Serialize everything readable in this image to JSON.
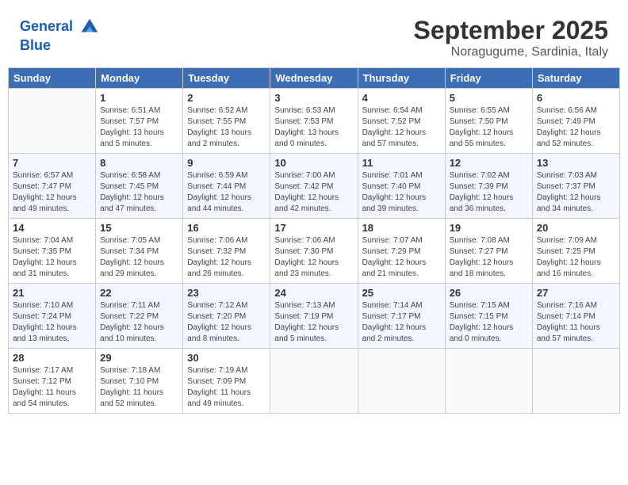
{
  "header": {
    "logo_line1": "General",
    "logo_line2": "Blue",
    "month": "September 2025",
    "location": "Noragugume, Sardinia, Italy"
  },
  "days_of_week": [
    "Sunday",
    "Monday",
    "Tuesday",
    "Wednesday",
    "Thursday",
    "Friday",
    "Saturday"
  ],
  "weeks": [
    [
      {
        "day": "",
        "info": ""
      },
      {
        "day": "1",
        "info": "Sunrise: 6:51 AM\nSunset: 7:57 PM\nDaylight: 13 hours\nand 5 minutes."
      },
      {
        "day": "2",
        "info": "Sunrise: 6:52 AM\nSunset: 7:55 PM\nDaylight: 13 hours\nand 2 minutes."
      },
      {
        "day": "3",
        "info": "Sunrise: 6:53 AM\nSunset: 7:53 PM\nDaylight: 13 hours\nand 0 minutes."
      },
      {
        "day": "4",
        "info": "Sunrise: 6:54 AM\nSunset: 7:52 PM\nDaylight: 12 hours\nand 57 minutes."
      },
      {
        "day": "5",
        "info": "Sunrise: 6:55 AM\nSunset: 7:50 PM\nDaylight: 12 hours\nand 55 minutes."
      },
      {
        "day": "6",
        "info": "Sunrise: 6:56 AM\nSunset: 7:49 PM\nDaylight: 12 hours\nand 52 minutes."
      }
    ],
    [
      {
        "day": "7",
        "info": "Sunrise: 6:57 AM\nSunset: 7:47 PM\nDaylight: 12 hours\nand 49 minutes."
      },
      {
        "day": "8",
        "info": "Sunrise: 6:58 AM\nSunset: 7:45 PM\nDaylight: 12 hours\nand 47 minutes."
      },
      {
        "day": "9",
        "info": "Sunrise: 6:59 AM\nSunset: 7:44 PM\nDaylight: 12 hours\nand 44 minutes."
      },
      {
        "day": "10",
        "info": "Sunrise: 7:00 AM\nSunset: 7:42 PM\nDaylight: 12 hours\nand 42 minutes."
      },
      {
        "day": "11",
        "info": "Sunrise: 7:01 AM\nSunset: 7:40 PM\nDaylight: 12 hours\nand 39 minutes."
      },
      {
        "day": "12",
        "info": "Sunrise: 7:02 AM\nSunset: 7:39 PM\nDaylight: 12 hours\nand 36 minutes."
      },
      {
        "day": "13",
        "info": "Sunrise: 7:03 AM\nSunset: 7:37 PM\nDaylight: 12 hours\nand 34 minutes."
      }
    ],
    [
      {
        "day": "14",
        "info": "Sunrise: 7:04 AM\nSunset: 7:35 PM\nDaylight: 12 hours\nand 31 minutes."
      },
      {
        "day": "15",
        "info": "Sunrise: 7:05 AM\nSunset: 7:34 PM\nDaylight: 12 hours\nand 29 minutes."
      },
      {
        "day": "16",
        "info": "Sunrise: 7:06 AM\nSunset: 7:32 PM\nDaylight: 12 hours\nand 26 minutes."
      },
      {
        "day": "17",
        "info": "Sunrise: 7:06 AM\nSunset: 7:30 PM\nDaylight: 12 hours\nand 23 minutes."
      },
      {
        "day": "18",
        "info": "Sunrise: 7:07 AM\nSunset: 7:29 PM\nDaylight: 12 hours\nand 21 minutes."
      },
      {
        "day": "19",
        "info": "Sunrise: 7:08 AM\nSunset: 7:27 PM\nDaylight: 12 hours\nand 18 minutes."
      },
      {
        "day": "20",
        "info": "Sunrise: 7:09 AM\nSunset: 7:25 PM\nDaylight: 12 hours\nand 16 minutes."
      }
    ],
    [
      {
        "day": "21",
        "info": "Sunrise: 7:10 AM\nSunset: 7:24 PM\nDaylight: 12 hours\nand 13 minutes."
      },
      {
        "day": "22",
        "info": "Sunrise: 7:11 AM\nSunset: 7:22 PM\nDaylight: 12 hours\nand 10 minutes."
      },
      {
        "day": "23",
        "info": "Sunrise: 7:12 AM\nSunset: 7:20 PM\nDaylight: 12 hours\nand 8 minutes."
      },
      {
        "day": "24",
        "info": "Sunrise: 7:13 AM\nSunset: 7:19 PM\nDaylight: 12 hours\nand 5 minutes."
      },
      {
        "day": "25",
        "info": "Sunrise: 7:14 AM\nSunset: 7:17 PM\nDaylight: 12 hours\nand 2 minutes."
      },
      {
        "day": "26",
        "info": "Sunrise: 7:15 AM\nSunset: 7:15 PM\nDaylight: 12 hours\nand 0 minutes."
      },
      {
        "day": "27",
        "info": "Sunrise: 7:16 AM\nSunset: 7:14 PM\nDaylight: 11 hours\nand 57 minutes."
      }
    ],
    [
      {
        "day": "28",
        "info": "Sunrise: 7:17 AM\nSunset: 7:12 PM\nDaylight: 11 hours\nand 54 minutes."
      },
      {
        "day": "29",
        "info": "Sunrise: 7:18 AM\nSunset: 7:10 PM\nDaylight: 11 hours\nand 52 minutes."
      },
      {
        "day": "30",
        "info": "Sunrise: 7:19 AM\nSunset: 7:09 PM\nDaylight: 11 hours\nand 49 minutes."
      },
      {
        "day": "",
        "info": ""
      },
      {
        "day": "",
        "info": ""
      },
      {
        "day": "",
        "info": ""
      },
      {
        "day": "",
        "info": ""
      }
    ]
  ]
}
